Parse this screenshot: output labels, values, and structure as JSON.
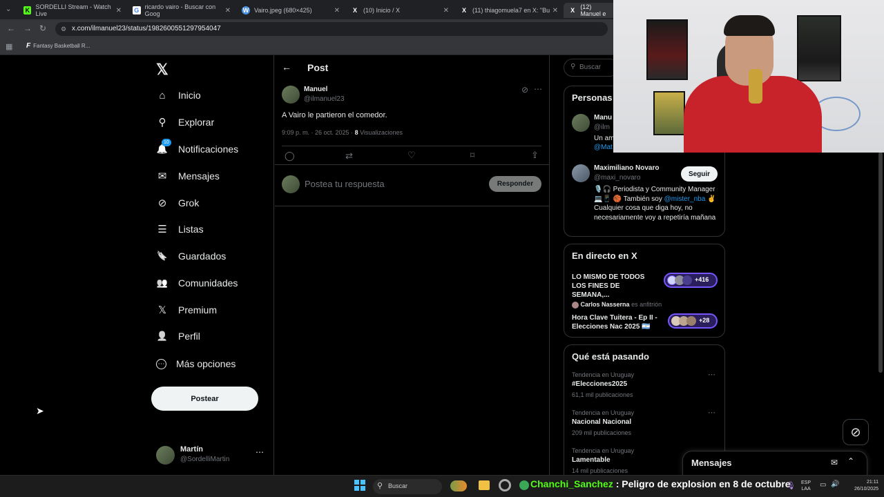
{
  "browser": {
    "tabs": [
      {
        "title": "SORDELLI Stream - Watch Live",
        "fav": "K",
        "fav_color": "#53fc18"
      },
      {
        "title": "ricardo vairo - Buscar con Goog",
        "fav": "G",
        "fav_color": "#ffffff"
      },
      {
        "title": "Vairo.jpeg (680×425)",
        "fav": "W",
        "fav_color": "#4a90e2"
      },
      {
        "title": "(10) Inicio / X",
        "fav": "X",
        "fav_color": "#000000"
      },
      {
        "title": "(11) thiagomuela7 en X: \"Bu",
        "fav": "X",
        "fav_color": "#000000"
      },
      {
        "title": "(12) Manuel e",
        "fav": "X",
        "fav_color": "#000000"
      }
    ],
    "url": "x.com/ilmanuel23/status/1982600551297954047",
    "bookmark": "Fantasy Basketball R..."
  },
  "nav": {
    "items": [
      {
        "label": "Inicio",
        "icon": "home-icon",
        "glyph": "⌂"
      },
      {
        "label": "Explorar",
        "icon": "search-icon",
        "glyph": "⚲"
      },
      {
        "label": "Notificaciones",
        "icon": "bell-icon",
        "glyph": "🔔"
      },
      {
        "label": "Mensajes",
        "icon": "mail-icon",
        "glyph": "✉"
      },
      {
        "label": "Grok",
        "icon": "grok-icon",
        "glyph": "⊘"
      },
      {
        "label": "Listas",
        "icon": "list-icon",
        "glyph": "☰"
      },
      {
        "label": "Guardados",
        "icon": "bookmark-icon",
        "glyph": "🔖"
      },
      {
        "label": "Comunidades",
        "icon": "communities-icon",
        "glyph": "👥"
      },
      {
        "label": "Premium",
        "icon": "x-premium-icon",
        "glyph": "𝕏"
      },
      {
        "label": "Perfil",
        "icon": "profile-icon",
        "glyph": "👤"
      },
      {
        "label": "Más opciones",
        "icon": "more-circle-icon",
        "glyph": "⋯"
      }
    ],
    "notif_badge": "10",
    "post_button": "Postear",
    "account": {
      "name": "Martín",
      "handle": "@SordelliMartin"
    }
  },
  "post": {
    "header": "Post",
    "author_name": "Manuel",
    "author_handle": "@ilmanuel23",
    "text": "A Vairo le partieron el comedor.",
    "meta": "9:09 p. m. · 26 oct. 2025 · ",
    "views_count": "8",
    "views_label": "Visualizaciones",
    "reply_placeholder": "Postea tu respuesta",
    "reply_button": "Responder"
  },
  "sidebar": {
    "search_placeholder": "Buscar",
    "people_title": "Personas",
    "person1": {
      "name": "Manu",
      "handle": "@ilm",
      "bio": "Un am",
      "mention": "@Mat"
    },
    "person2": {
      "name": "Maximiliano Novaro",
      "handle": "@maxi_novaro",
      "follow": "Seguir",
      "bio1": "🎙️🎧 Periodista y Community Manager 💻📱 🏀 También soy ",
      "mention": "@mister_nba",
      "bio2": " ✌️ Cualquier cosa que diga hoy, no necesariamente voy a repetiría mañana"
    },
    "live_title": "En directo en X",
    "live1": {
      "title": "LO MISMO DE TODOS LOS FINES DE SEMANA,...",
      "count": "+416"
    },
    "live2": {
      "host": "Carlos Nasserna",
      "host_suffix": " es anfitrión",
      "title": "Hora Clave Tuitera - Ep II - Elecciones Nac 2025 🇦🇷",
      "count": "+28"
    },
    "trends_title": "Qué está pasando",
    "trends": [
      {
        "context": "Tendencia en Uruguay",
        "name": "#Elecciones2025",
        "posts": "61,1 mil publicaciones"
      },
      {
        "context": "Tendencia en Uruguay",
        "name": "Nacional Nacional",
        "posts": "209 mil publicaciones"
      },
      {
        "context": "Tendencia en Uruguay",
        "name": "Lamentable",
        "posts": "14 mil publicaciones"
      }
    ],
    "messages": "Mensajes"
  },
  "taskbar": {
    "search": "Buscar",
    "ticker_user": "Chanchi_Sanchez",
    "ticker_sep": " : ",
    "ticker_text": "Peligro de explosion en 8 de octubre",
    "lang1": "ESP",
    "lang2": "LAA",
    "time": "21:11",
    "date": "26/10/2025"
  },
  "colors": {
    "accent": "#1d9bf0",
    "live_pill": "#7856ff",
    "tab_bg": "#202124"
  }
}
